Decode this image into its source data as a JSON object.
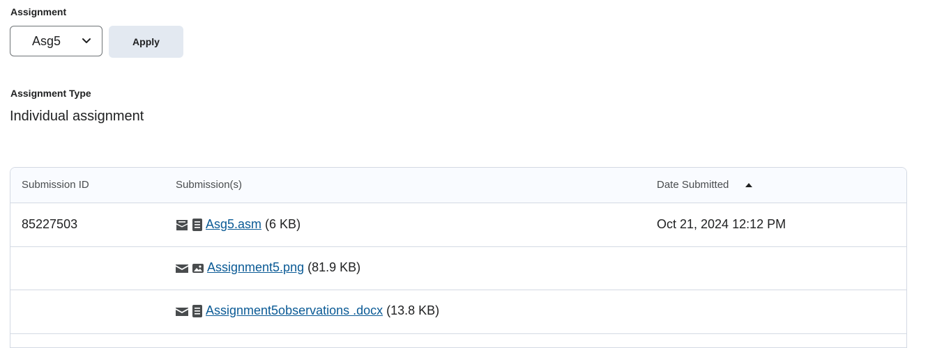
{
  "assignment": {
    "label": "Assignment",
    "selected": "Asg5",
    "apply_label": "Apply"
  },
  "assignment_type": {
    "label": "Assignment Type",
    "value": "Individual assignment"
  },
  "table": {
    "headers": {
      "submission_id": "Submission ID",
      "submissions": "Submission(s)",
      "date_submitted": "Date Submitted"
    },
    "sort": "ascending",
    "rows": [
      {
        "id": "85227503",
        "file_icons": [
          "archive-envelope-icon",
          "document-icon"
        ],
        "file_name": "Asg5.asm",
        "file_size": "(6 KB)",
        "date": "Oct 21, 2024 12:12 PM"
      },
      {
        "id": "",
        "file_icons": [
          "envelope-icon",
          "image-icon"
        ],
        "file_name": "Assignment5.png",
        "file_size": "(81.9 KB)",
        "date": ""
      },
      {
        "id": "",
        "file_icons": [
          "envelope-icon",
          "document-icon"
        ],
        "file_name": "Assignment5observations .docx",
        "file_size": "(13.8 KB)",
        "date": ""
      }
    ]
  },
  "colors": {
    "link": "#0a5a95",
    "button_bg": "#e3e9f1",
    "header_bg": "#f9fbff",
    "border": "#d3d9e3"
  }
}
